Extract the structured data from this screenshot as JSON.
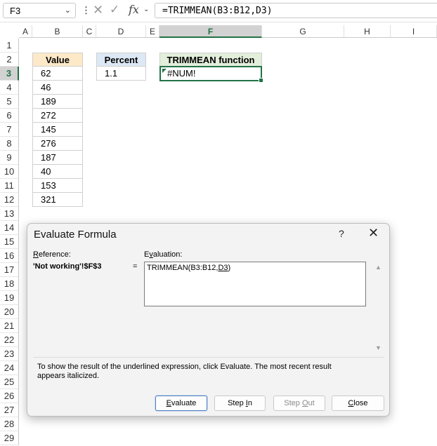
{
  "formula_bar": {
    "name_box": "F3",
    "formula": "=TRIMMEAN(B3:B12,D3)",
    "fx_label": "fx"
  },
  "columns": [
    "A",
    "B",
    "C",
    "D",
    "E",
    "F",
    "G",
    "H",
    "I"
  ],
  "selected_column": "F",
  "rows": [
    "1",
    "2",
    "3",
    "4",
    "5",
    "6",
    "7",
    "8",
    "9",
    "10",
    "11",
    "12",
    "13",
    "14",
    "15",
    "16",
    "17",
    "18",
    "19",
    "20",
    "21",
    "22",
    "23",
    "24",
    "25",
    "26",
    "27",
    "28",
    "29"
  ],
  "selected_row": "3",
  "sheet": {
    "value_header": "Value",
    "values": [
      "62",
      "46",
      "189",
      "272",
      "145",
      "276",
      "187",
      "40",
      "153",
      "321"
    ],
    "percent_header": "Percent",
    "percent_value": "1.1",
    "function_header": "TRIMMEAN function",
    "function_result": "#NUM!"
  },
  "colors": {
    "value_header_bg": "#fde9c8",
    "percent_header_bg": "#dde8f5",
    "function_header_bg": "#e3eedb",
    "accent": "#217346"
  },
  "dialog": {
    "title": "Evaluate Formula",
    "help": "?",
    "close_icon": "✕",
    "reference_label": "Reference:",
    "reference_value": "'Not working'!$F$3",
    "equals": "=",
    "evaluation_label": "Evaluation:",
    "evaluation_prefix": "TRIMMEAN(B3:B12,",
    "evaluation_underlined": "D3",
    "evaluation_suffix": ")",
    "message": "To show the result of the underlined expression, click Evaluate.  The most recent result appears italicized.",
    "buttons": {
      "evaluate": "Evaluate",
      "step_in": "Step In",
      "step_out": "Step Out",
      "close": "Close"
    }
  }
}
